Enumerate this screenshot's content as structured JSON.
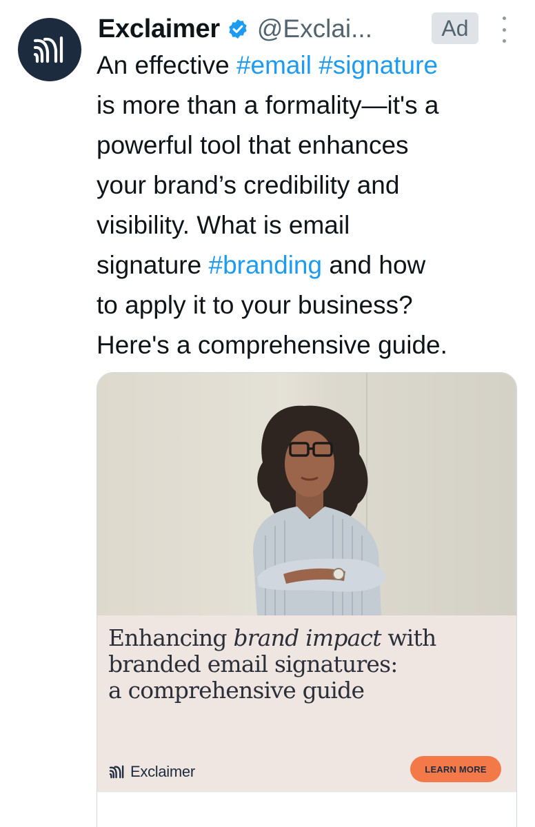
{
  "tweet": {
    "author": {
      "name": "Exclaimer",
      "handle": "@Exclai..."
    },
    "ad_label": "Ad",
    "text_lines": [
      {
        "segments": [
          {
            "t": "An effective ",
            "tag": false
          },
          {
            "t": "#email",
            "tag": true
          },
          {
            "t": " ",
            "tag": false
          },
          {
            "t": "#signature",
            "tag": true
          }
        ]
      },
      {
        "segments": [
          {
            "t": "is more than a formality—it's a",
            "tag": false
          }
        ]
      },
      {
        "segments": [
          {
            "t": "powerful tool that enhances",
            "tag": false
          }
        ]
      },
      {
        "segments": [
          {
            "t": "your brand’s credibility and",
            "tag": false
          }
        ]
      },
      {
        "segments": [
          {
            "t": "visibility. What is email",
            "tag": false
          }
        ]
      },
      {
        "segments": [
          {
            "t": "signature ",
            "tag": false
          },
          {
            "t": "#branding",
            "tag": true
          },
          {
            "t": " and how",
            "tag": false
          }
        ]
      },
      {
        "segments": [
          {
            "t": "to apply it to your business?",
            "tag": false
          }
        ]
      },
      {
        "segments": [
          {
            "t": "Here's a comprehensive guide.",
            "tag": false
          }
        ]
      }
    ]
  },
  "card": {
    "title_line1_pre": "Enhancing ",
    "title_line1_em": "brand impact",
    "title_line1_post": " with",
    "title_line2": "branded email signatures:",
    "title_line3": "a comprehensive guide",
    "brand_name": "Exclaimer",
    "cta_label": "LEARN MORE"
  },
  "colors": {
    "hashtag": "#1d9bf0",
    "avatar_bg": "#1d2b3f",
    "cta_bg": "#f37a48",
    "banner_bg": "#efe6e2"
  },
  "icons": {
    "verified": "verified-badge-icon",
    "more": "more-dots-icon",
    "logo": "exclaimer-logo-icon"
  }
}
